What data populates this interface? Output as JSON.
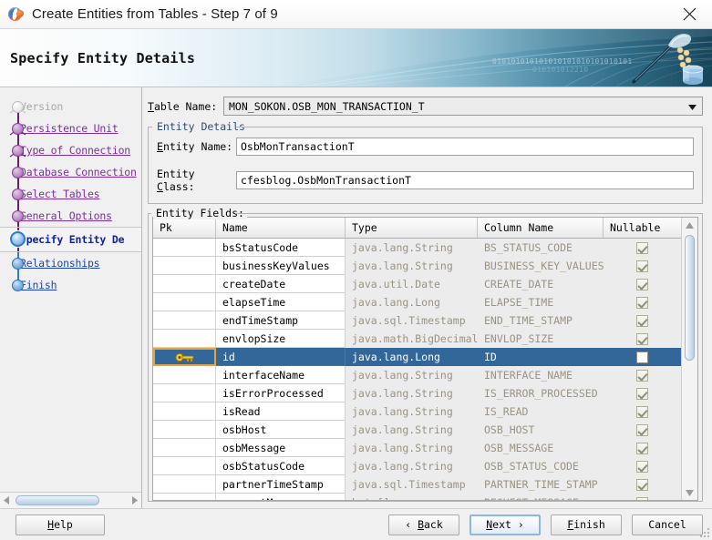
{
  "window": {
    "title": "Create Entities from Tables - Step 7 of 9",
    "app_icon": "netbeans-logo-icon",
    "close_icon": "close-icon"
  },
  "banner": {
    "headline": "Specify Entity Details",
    "binary_1": "010101010101010101010101010101",
    "binary_2": "010101012210",
    "art_icon": "pipette-database-art-icon"
  },
  "sidebar": {
    "steps": [
      {
        "label": "Version",
        "state": "inactive"
      },
      {
        "label": "Persistence Unit",
        "state": "done"
      },
      {
        "label": "Type of Connection",
        "state": "done"
      },
      {
        "label": "Database Connection",
        "state": "done"
      },
      {
        "label": "Select Tables",
        "state": "done"
      },
      {
        "label": "General Options",
        "state": "done"
      },
      {
        "label": "Specify Entity De",
        "state": "current"
      },
      {
        "label": "Relationships",
        "state": "pending"
      },
      {
        "label": "Finish",
        "state": "pending"
      }
    ],
    "scroll_left_icon": "triangle-left-icon",
    "scroll_right_icon": "triangle-right-icon"
  },
  "form": {
    "table_name_label": "Table Name:",
    "table_name_value": "MON_SOKON.OSB_MON_TRANSACTION_T",
    "table_name_caret_icon": "chevron-down-icon",
    "entity_details_title": "Entity Details",
    "entity_name_label": "Entity Name:",
    "entity_name_value": "OsbMonTransactionT",
    "entity_class_label": "Entity Class:",
    "entity_class_value": "cfesblog.OsbMonTransactionT"
  },
  "fields_panel": {
    "title": "Entity Fields:",
    "columns": [
      "Pk",
      "Name",
      "Type",
      "Column Name",
      "Nullable"
    ],
    "rows": [
      {
        "pk": false,
        "name": "bsStatusCode",
        "type": "java.lang.String",
        "column": "BS_STATUS_CODE",
        "nullable": true,
        "selected": false
      },
      {
        "pk": false,
        "name": "businessKeyValues",
        "type": "java.lang.String",
        "column": "BUSINESS_KEY_VALUES",
        "nullable": true,
        "selected": false
      },
      {
        "pk": false,
        "name": "createDate",
        "type": "java.util.Date",
        "column": "CREATE_DATE",
        "nullable": true,
        "selected": false
      },
      {
        "pk": false,
        "name": "elapseTime",
        "type": "java.lang.Long",
        "column": "ELAPSE_TIME",
        "nullable": true,
        "selected": false
      },
      {
        "pk": false,
        "name": "endTimeStamp",
        "type": "java.sql.Timestamp",
        "column": "END_TIME_STAMP",
        "nullable": true,
        "selected": false
      },
      {
        "pk": false,
        "name": "envlopSize",
        "type": "java.math.BigDecimal",
        "column": "ENVLOP_SIZE",
        "nullable": true,
        "selected": false
      },
      {
        "pk": true,
        "name": "id",
        "type": "java.lang.Long",
        "column": "ID",
        "nullable": false,
        "selected": true
      },
      {
        "pk": false,
        "name": "interfaceName",
        "type": "java.lang.String",
        "column": "INTERFACE_NAME",
        "nullable": true,
        "selected": false
      },
      {
        "pk": false,
        "name": "isErrorProcessed",
        "type": "java.lang.String",
        "column": "IS_ERROR_PROCESSED",
        "nullable": true,
        "selected": false
      },
      {
        "pk": false,
        "name": "isRead",
        "type": "java.lang.String",
        "column": "IS_READ",
        "nullable": true,
        "selected": false
      },
      {
        "pk": false,
        "name": "osbHost",
        "type": "java.lang.String",
        "column": "OSB_HOST",
        "nullable": true,
        "selected": false
      },
      {
        "pk": false,
        "name": "osbMessage",
        "type": "java.lang.String",
        "column": "OSB_MESSAGE",
        "nullable": true,
        "selected": false
      },
      {
        "pk": false,
        "name": "osbStatusCode",
        "type": "java.lang.String",
        "column": "OSB_STATUS_CODE",
        "nullable": true,
        "selected": false
      },
      {
        "pk": false,
        "name": "partnerTimeStamp",
        "type": "java.sql.Timestamp",
        "column": "PARTNER_TIME_STAMP",
        "nullable": true,
        "selected": false
      },
      {
        "pk": false,
        "name": "requestMessage",
        "type": "byte[]",
        "column": "REQUEST_MESSAGE",
        "nullable": true,
        "selected": false
      }
    ],
    "pk_icon": "key-icon",
    "scroll_up_icon": "triangle-up-icon",
    "scroll_down_icon": "triangle-down-icon"
  },
  "footer": {
    "help": "Help",
    "back": "‹ Back",
    "next": "Next ›",
    "finish": "Finish",
    "cancel": "Cancel"
  },
  "colors": {
    "selection_blue": "#336699",
    "pk_focus_orange": "#e8a33d",
    "link_purple": "#7b2fa0",
    "link_blue": "#1b43b8",
    "current_step": "#10249c",
    "banner_dark": "#17455c"
  }
}
